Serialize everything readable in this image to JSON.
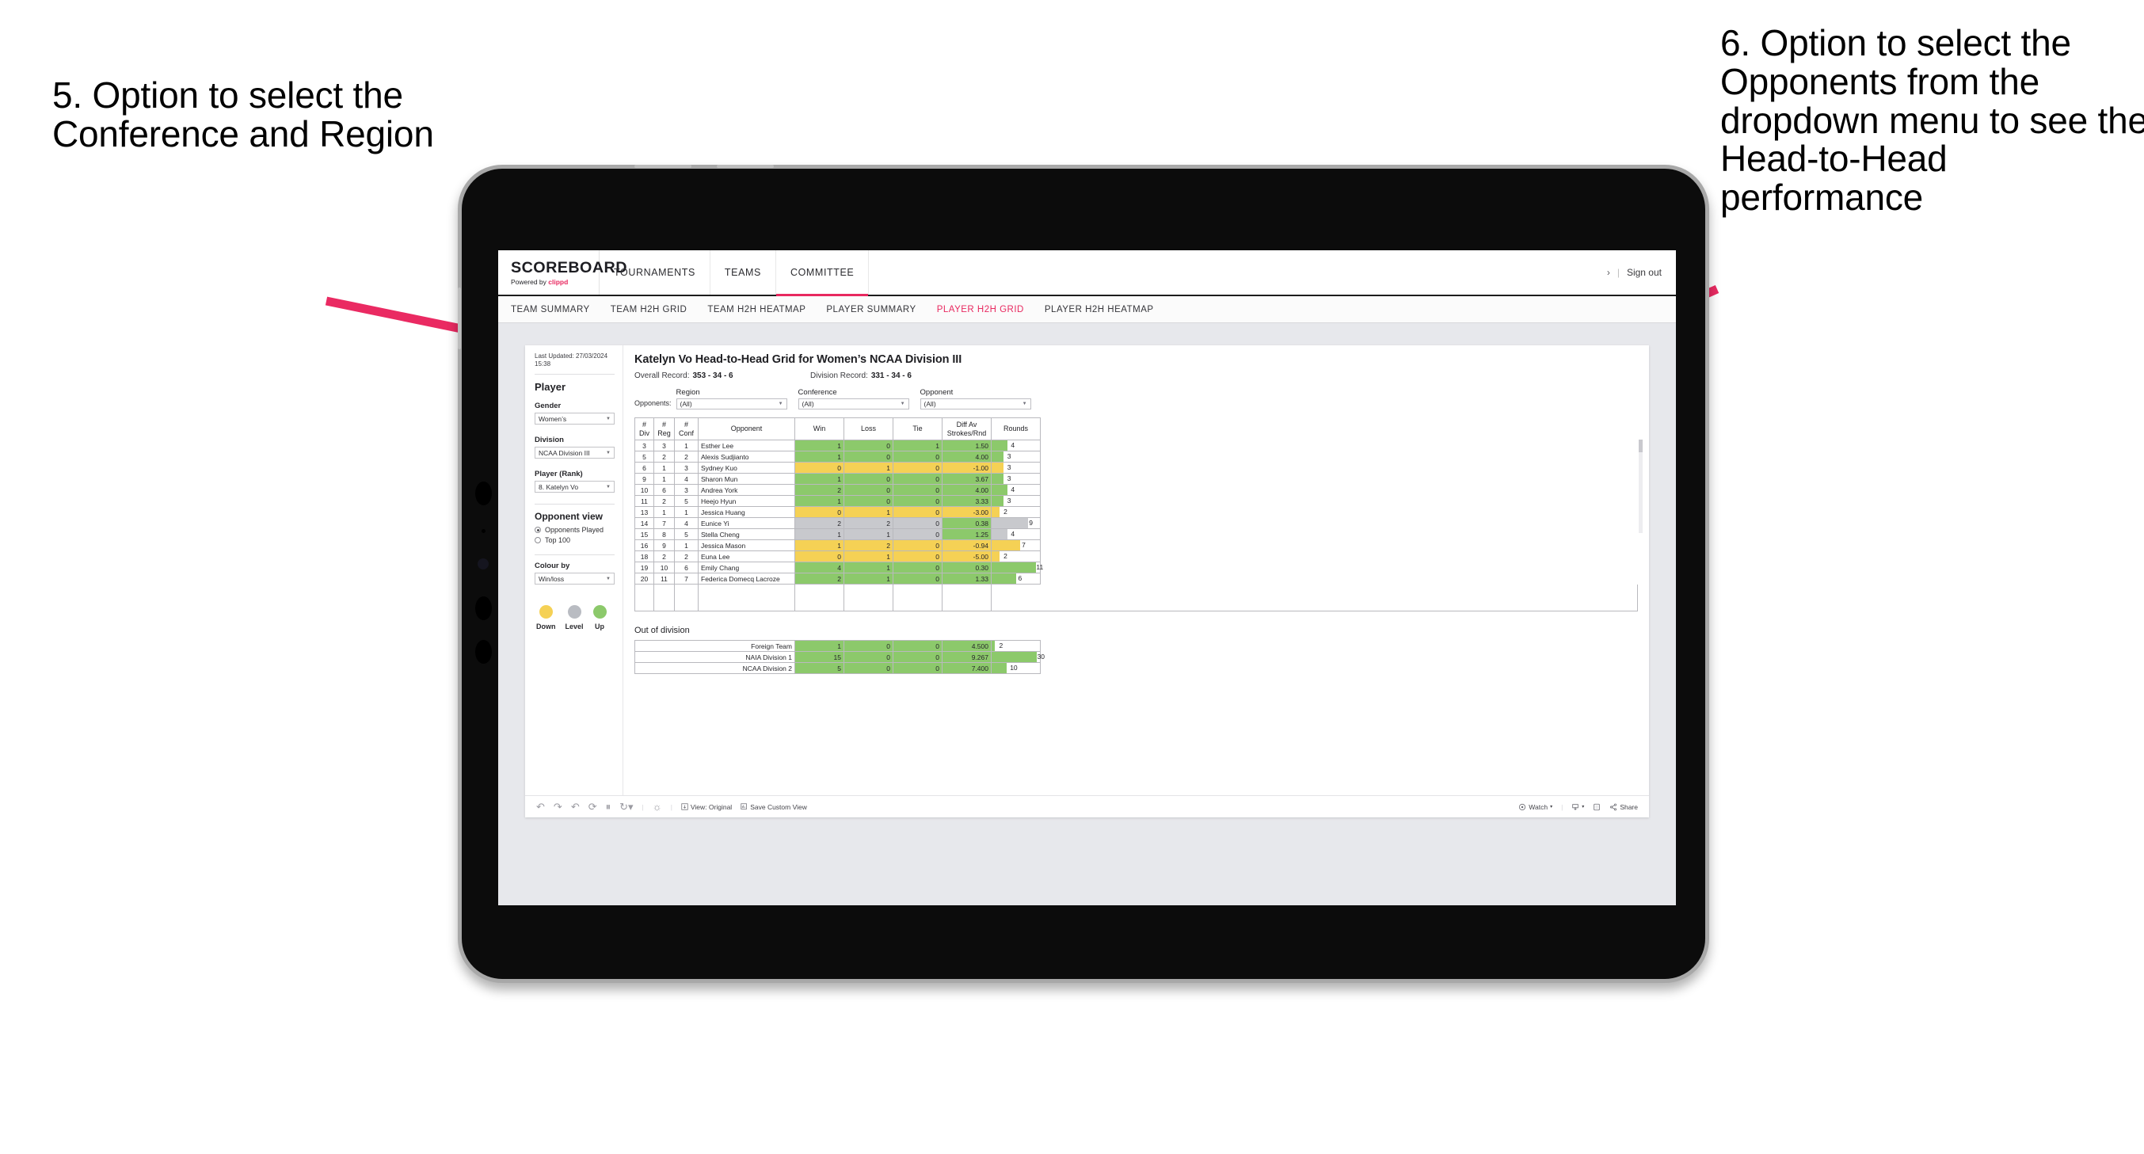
{
  "annotations": {
    "left": "5. Option to select the Conference and Region",
    "right": "6. Option to select the Opponents from the dropdown menu to see the Head-to-Head performance",
    "arrow_color": "#ea2a62"
  },
  "header": {
    "brand_name": "SCOREBOARD",
    "powered_prefix": "Powered by ",
    "powered_brand": "clippd",
    "nav": [
      {
        "label": "TOURNAMENTS",
        "active": false
      },
      {
        "label": "TEAMS",
        "active": false
      },
      {
        "label": "COMMITTEE",
        "active": true
      }
    ],
    "account_arrow": "›",
    "separator": "|",
    "sign_out": "Sign out"
  },
  "subnav": [
    {
      "label": "TEAM SUMMARY",
      "active": false
    },
    {
      "label": "TEAM H2H GRID",
      "active": false
    },
    {
      "label": "TEAM H2H HEATMAP",
      "active": false
    },
    {
      "label": "PLAYER SUMMARY",
      "active": false
    },
    {
      "label": "PLAYER H2H GRID",
      "active": true
    },
    {
      "label": "PLAYER H2H HEATMAP",
      "active": false
    }
  ],
  "sidebar": {
    "last_updated": "Last Updated: 27/03/2024 15:38",
    "player_heading": "Player",
    "gender_label": "Gender",
    "gender_value": "Women’s",
    "division_label": "Division",
    "division_value": "NCAA Division III",
    "player_rank_label": "Player (Rank)",
    "player_rank_value": "8. Katelyn Vo",
    "opponent_view_heading": "Opponent view",
    "opponent_view_options": [
      {
        "label": "Opponents Played",
        "selected": true
      },
      {
        "label": "Top 100",
        "selected": false
      }
    ],
    "colour_by_label": "Colour by",
    "colour_by_value": "Win/loss",
    "legend": [
      {
        "label": "Down",
        "color": "#f5d155"
      },
      {
        "label": "Level",
        "color": "#b9bcc2"
      },
      {
        "label": "Up",
        "color": "#8cc96b"
      }
    ]
  },
  "viz": {
    "title": "Katelyn Vo Head-to-Head Grid for Women’s NCAA Division III",
    "overall_record_label": "Overall Record:",
    "overall_record_value": "353 - 34 - 6",
    "division_record_label": "Division Record:",
    "division_record_value": "331 - 34 - 6",
    "filters_prefix": "Opponents:",
    "filters": [
      {
        "label": "Region",
        "value": "(All)"
      },
      {
        "label": "Conference",
        "value": "(All)"
      },
      {
        "label": "Opponent",
        "value": "(All)"
      }
    ],
    "out_of_division_title": "Out of division"
  },
  "chart_data": {
    "type": "table",
    "title": "Katelyn Vo Head-to-Head Grid for Women’s NCAA Division III",
    "columns": [
      "# Div",
      "# Reg",
      "# Conf",
      "Opponent",
      "Win",
      "Loss",
      "Tie",
      "Diff Av Strokes/Rnd",
      "Rounds"
    ],
    "column_headers_multiline": [
      [
        "#",
        "Div"
      ],
      [
        "#",
        "Reg"
      ],
      [
        "#",
        "Conf"
      ],
      [
        "Opponent"
      ],
      [
        "Win"
      ],
      [
        "Loss"
      ],
      [
        "Tie"
      ],
      [
        "Diff Av",
        "Strokes/Rnd"
      ],
      [
        "Rounds"
      ]
    ],
    "colour_scale": {
      "up": "#8cc96b",
      "level": "#c8c9cd",
      "down": "#f5d155"
    },
    "rounds_max": 12,
    "rows": [
      {
        "div": "3",
        "reg": "3",
        "conf": "1",
        "opponent": "Esther Lee",
        "win": "1",
        "loss": "0",
        "tie": "1",
        "diff": "1.50",
        "rounds": "4",
        "status": "up"
      },
      {
        "div": "5",
        "reg": "2",
        "conf": "2",
        "opponent": "Alexis Sudjianto",
        "win": "1",
        "loss": "0",
        "tie": "0",
        "diff": "4.00",
        "rounds": "3",
        "status": "up"
      },
      {
        "div": "6",
        "reg": "1",
        "conf": "3",
        "opponent": "Sydney Kuo",
        "win": "0",
        "loss": "1",
        "tie": "0",
        "diff": "-1.00",
        "rounds": "3",
        "status": "down"
      },
      {
        "div": "9",
        "reg": "1",
        "conf": "4",
        "opponent": "Sharon Mun",
        "win": "1",
        "loss": "0",
        "tie": "0",
        "diff": "3.67",
        "rounds": "3",
        "status": "up"
      },
      {
        "div": "10",
        "reg": "6",
        "conf": "3",
        "opponent": "Andrea York",
        "win": "2",
        "loss": "0",
        "tie": "0",
        "diff": "4.00",
        "rounds": "4",
        "status": "up"
      },
      {
        "div": "11",
        "reg": "2",
        "conf": "5",
        "opponent": "Heejo Hyun",
        "win": "1",
        "loss": "0",
        "tie": "0",
        "diff": "3.33",
        "rounds": "3",
        "status": "up"
      },
      {
        "div": "13",
        "reg": "1",
        "conf": "1",
        "opponent": "Jessica Huang",
        "win": "0",
        "loss": "1",
        "tie": "0",
        "diff": "-3.00",
        "rounds": "2",
        "status": "down"
      },
      {
        "div": "14",
        "reg": "7",
        "conf": "4",
        "opponent": "Eunice Yi",
        "win": "2",
        "loss": "2",
        "tie": "0",
        "diff": "0.38",
        "rounds": "9",
        "status": "level",
        "diff_status": "up"
      },
      {
        "div": "15",
        "reg": "8",
        "conf": "5",
        "opponent": "Stella Cheng",
        "win": "1",
        "loss": "1",
        "tie": "0",
        "diff": "1.25",
        "rounds": "4",
        "status": "level",
        "diff_status": "up"
      },
      {
        "div": "16",
        "reg": "9",
        "conf": "1",
        "opponent": "Jessica Mason",
        "win": "1",
        "loss": "2",
        "tie": "0",
        "diff": "-0.94",
        "rounds": "7",
        "status": "down"
      },
      {
        "div": "18",
        "reg": "2",
        "conf": "2",
        "opponent": "Euna Lee",
        "win": "0",
        "loss": "1",
        "tie": "0",
        "diff": "-5.00",
        "rounds": "2",
        "status": "down"
      },
      {
        "div": "19",
        "reg": "10",
        "conf": "6",
        "opponent": "Emily Chang",
        "win": "4",
        "loss": "1",
        "tie": "0",
        "diff": "0.30",
        "rounds": "11",
        "status": "up"
      },
      {
        "div": "20",
        "reg": "11",
        "conf": "7",
        "opponent": "Federica Domecq Lacroze",
        "win": "2",
        "loss": "1",
        "tie": "0",
        "diff": "1.33",
        "rounds": "6",
        "status": "up"
      }
    ],
    "out_of_division": {
      "title": "Out of division",
      "rounds_max": 32,
      "rows": [
        {
          "name": "Foreign Team",
          "win": "1",
          "loss": "0",
          "tie": "0",
          "diff": "4.500",
          "rounds": "2",
          "status": "up"
        },
        {
          "name": "NAIA Division 1",
          "win": "15",
          "loss": "0",
          "tie": "0",
          "diff": "9.267",
          "rounds": "30",
          "status": "up"
        },
        {
          "name": "NCAA Division 2",
          "win": "5",
          "loss": "0",
          "tie": "0",
          "diff": "7.400",
          "rounds": "10",
          "status": "up"
        }
      ]
    }
  },
  "toolbar": {
    "view_label": "View: Original",
    "save_label": "Save Custom View",
    "watch_label": "Watch",
    "share_label": "Share"
  }
}
